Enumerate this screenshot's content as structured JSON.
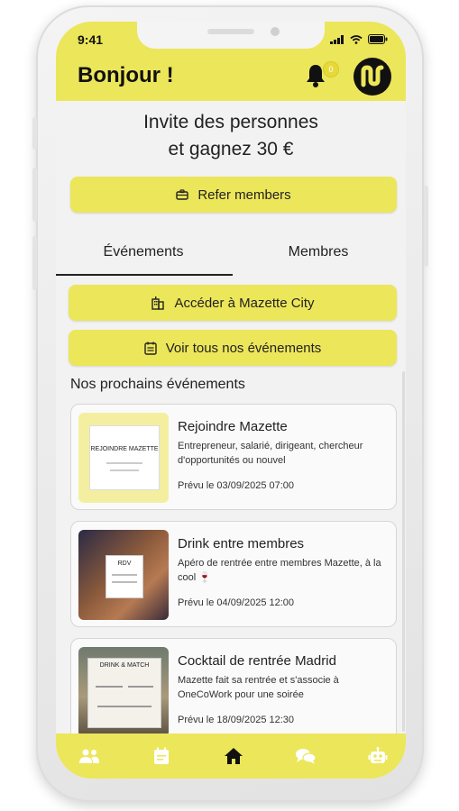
{
  "status": {
    "time": "9:41"
  },
  "header": {
    "greeting": "Bonjour !",
    "notification_count": "0"
  },
  "invite": {
    "line1": "Invite des personnes",
    "line2": "et gagnez 30 €",
    "refer_label": "Refer members"
  },
  "tabs": [
    {
      "label": "Événements",
      "active": true
    },
    {
      "label": "Membres",
      "active": false
    }
  ],
  "actions": {
    "city_label": "Accéder à Mazette City",
    "events_label": "Voir tous nos événements"
  },
  "section_title": "Nos prochains événements",
  "events": [
    {
      "title": "Rejoindre Mazette",
      "description": "Entrepreneur, salarié, dirigeant, chercheur d'opportunités ou nouvel",
      "date": "Prévu le 03/09/2025 07:00",
      "thumb_text": "REJOINDRE MAZETTE"
    },
    {
      "title": "Drink entre membres",
      "description": "Apéro de rentrée entre membres Mazette, à la cool 🍷",
      "date": "Prévu le 04/09/2025 12:00",
      "thumb_text": "RDV"
    },
    {
      "title": "Cocktail de rentrée Madrid",
      "description": "Mazette fait sa rentrée et s'associe à OneCoWork pour une soirée",
      "date": "Prévu le 18/09/2025 12:30",
      "thumb_text": "DRINK & MATCH"
    }
  ],
  "colors": {
    "accent": "#ece65a",
    "background": "#f2f2f2",
    "text": "#222222"
  },
  "nav": [
    "members-icon",
    "calendar-icon",
    "home-icon",
    "chat-icon",
    "bot-icon"
  ]
}
